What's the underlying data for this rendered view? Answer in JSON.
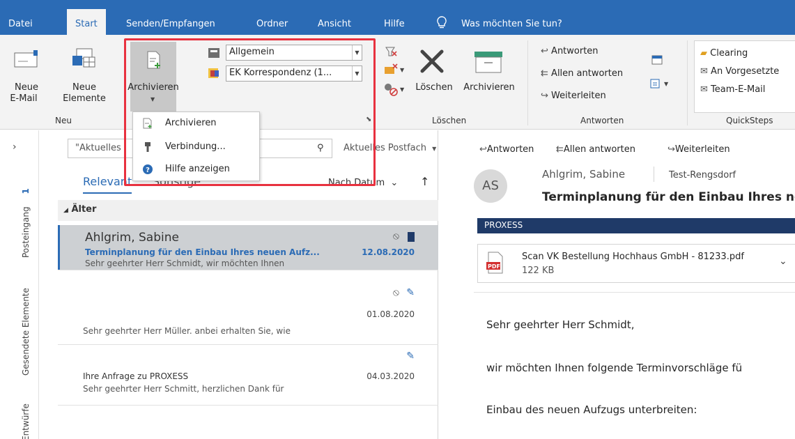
{
  "tabs": [
    {
      "label": "Datei"
    },
    {
      "label": "Start"
    },
    {
      "label": "Senden/Empfangen"
    },
    {
      "label": "Ordner"
    },
    {
      "label": "Ansicht"
    },
    {
      "label": "Hilfe"
    }
  ],
  "tellme": "Was möchten Sie tun?",
  "ribbon": {
    "neu": {
      "new_email": [
        "Neue",
        "E-Mail"
      ],
      "new_items": [
        "Neue",
        "Elemente"
      ],
      "group_label": "Neu"
    },
    "archive_btn": "Archivieren",
    "combo1": "Allgemein",
    "combo2": "EK Korrespondenz (1...",
    "delete_btn": "Löschen",
    "archive_btn2": "Archivieren",
    "loeschen_label": "Löschen",
    "respond": {
      "reply": "Antworten",
      "reply_all": "Allen antworten",
      "forward": "Weiterleiten",
      "group_label": "Antworten"
    },
    "quicksteps": {
      "items": [
        "Clearing",
        "An Vorgesetzte",
        "Team-E-Mail"
      ],
      "group_label": "QuickSteps"
    }
  },
  "dropdown": {
    "items": [
      "Archivieren",
      "Verbindung...",
      "Hilfe anzeigen"
    ]
  },
  "rail": {
    "inbox": "Posteingang",
    "inbox_count": "1",
    "sent": "Gesendete Elemente",
    "drafts": "Entwürfe"
  },
  "list": {
    "search_placeholder": "\"Aktuelles",
    "scope": "Aktuelles Postfach",
    "tab_relevant": "Relevant",
    "tab_other": "Sonstige",
    "sort": "Nach Datum",
    "group": "Älter",
    "mails": [
      {
        "sender": "Ahlgrim, Sabine",
        "subject": "Terminplanung für den Einbau Ihres neuen Aufz...",
        "preview": "Sehr geehrter Herr Schmidt,   wir möchten Ihnen",
        "date": "12.08.2020"
      },
      {
        "sender": "",
        "subject": "",
        "preview": "Sehr geehrter Herr Müller.   anbei erhalten Sie, wie",
        "date": "01.08.2020"
      },
      {
        "sender": "",
        "subject": "Ihre Anfrage zu PROXESS",
        "preview": "Sehr geehrter Herr Schmitt,   herzlichen Dank für",
        "date": "04.03.2020"
      }
    ]
  },
  "reader": {
    "actions": [
      "Antworten",
      "Allen antworten",
      "Weiterleiten"
    ],
    "avatar": "AS",
    "sender": "Ahlgrim, Sabine",
    "to": "Test-Rengsdorf",
    "subject": "Terminplanung für den Einbau Ihres ne",
    "category": "PROXESS",
    "attachment_name": "Scan VK Bestellung Hochhaus GmbH - 81233.pdf",
    "attachment_size": "122 KB",
    "pdf_label": "PDF",
    "body": [
      "Sehr geehrter Herr Schmidt,",
      "wir möchten Ihnen folgende Terminvorschläge fü",
      "Einbau des neuen Aufzugs unterbreiten:"
    ]
  },
  "colors": {
    "accent": "#2b6bb5",
    "highlight": "#e8313f",
    "category": "#1f3a68"
  }
}
